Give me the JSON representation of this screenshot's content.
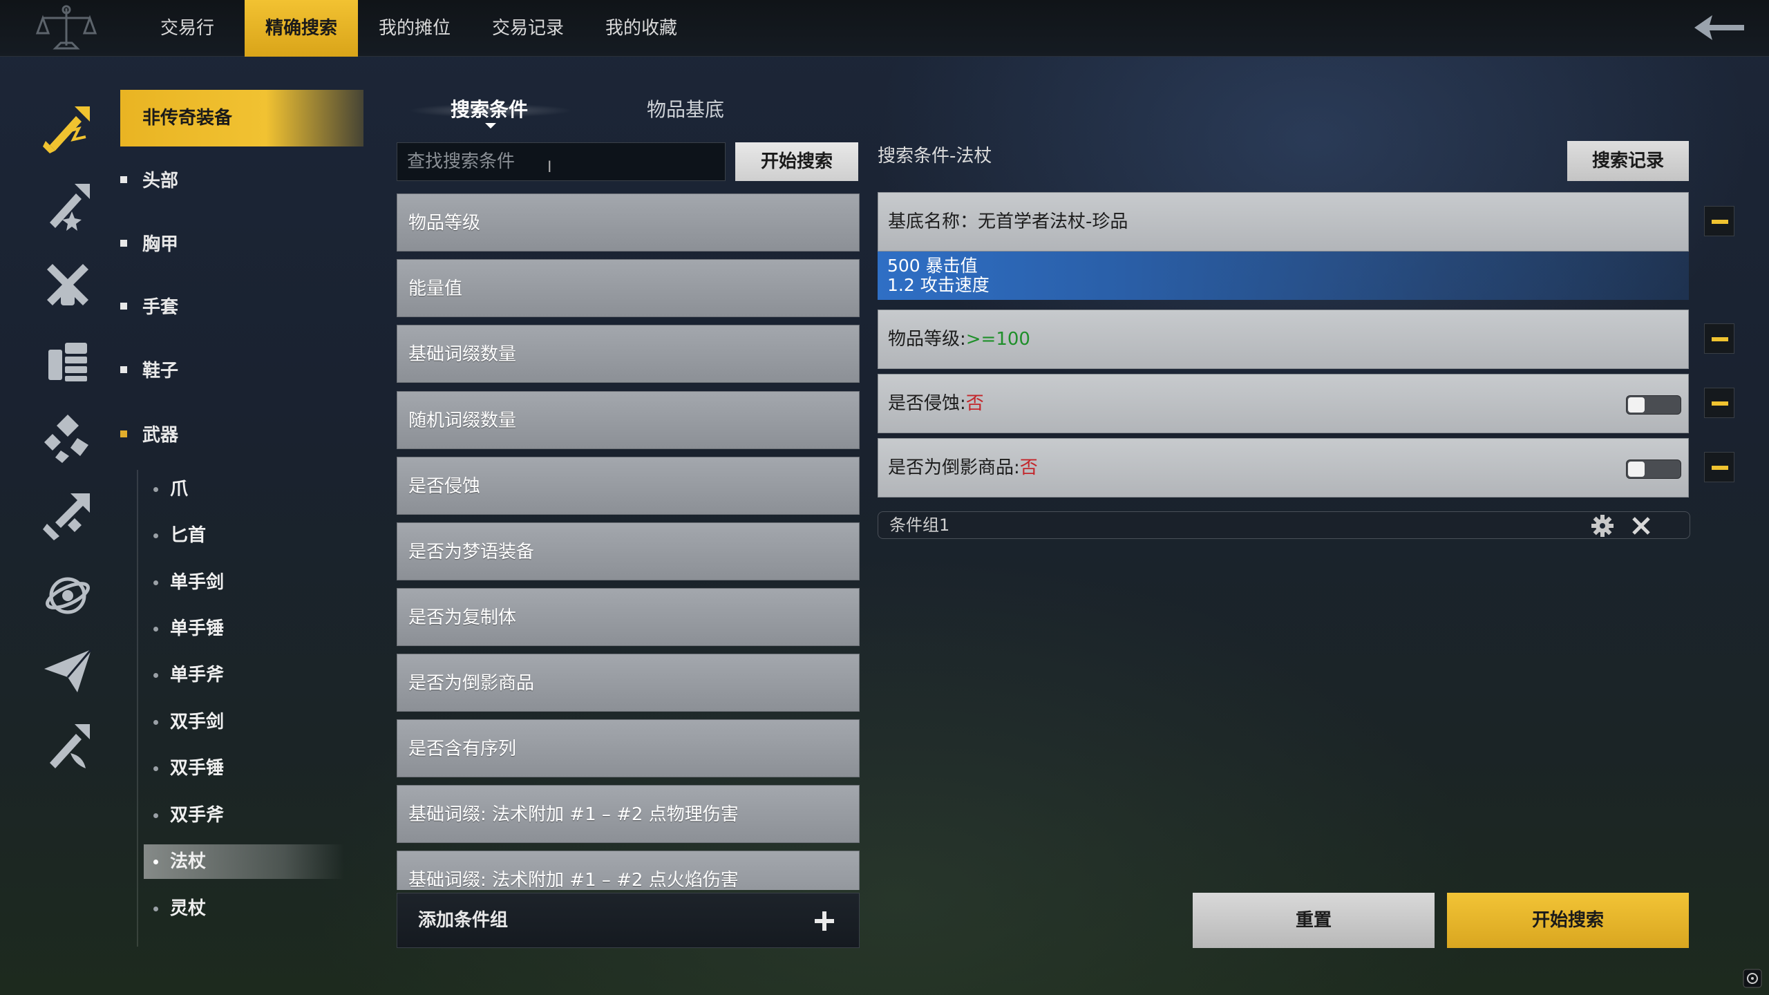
{
  "top_nav": {
    "tabs": [
      {
        "label": "交易行"
      },
      {
        "label": "精确搜索"
      },
      {
        "label": "我的摊位"
      },
      {
        "label": "交易记录"
      },
      {
        "label": "我的收藏"
      }
    ],
    "active_index": 1
  },
  "left_rail": {
    "icons": [
      "sword-lightning-icon",
      "sword-star-icon",
      "armor-icon",
      "inventory-icon",
      "shards-icon",
      "gear-parts-icon",
      "orbit-icon",
      "paper-plane-icon",
      "sword-feather-icon"
    ]
  },
  "category": {
    "active_label": "非传奇装备",
    "items": [
      {
        "label": "头部"
      },
      {
        "label": "胸甲"
      },
      {
        "label": "手套"
      },
      {
        "label": "鞋子"
      },
      {
        "label": "武器"
      }
    ],
    "sub_items": [
      {
        "label": "爪"
      },
      {
        "label": "匕首"
      },
      {
        "label": "单手剑"
      },
      {
        "label": "单手锤"
      },
      {
        "label": "单手斧"
      },
      {
        "label": "双手剑"
      },
      {
        "label": "双手锤"
      },
      {
        "label": "双手斧"
      },
      {
        "label": "法杖"
      },
      {
        "label": "灵杖"
      }
    ],
    "active_sub": "法杖"
  },
  "middle": {
    "tab_conditions": "搜索条件",
    "tab_base": "物品基底",
    "search_placeholder": "查找搜索条件",
    "search_button": "开始搜索",
    "conditions": [
      {
        "label": "物品等级"
      },
      {
        "label": "能量值"
      },
      {
        "label": "基础词缀数量"
      },
      {
        "label": "随机词缀数量"
      },
      {
        "label": "是否侵蚀"
      },
      {
        "label": "是否为梦语装备"
      },
      {
        "label": "是否为复制体"
      },
      {
        "label": "是否为倒影商品"
      },
      {
        "label": "是否含有序列"
      },
      {
        "label": "基础词缀: 法术附加 #1 – #2 点物理伤害"
      },
      {
        "label": "基础词缀: 法术附加 #1 – #2 点火焰伤害"
      }
    ],
    "add_group": "添加条件组"
  },
  "right": {
    "title": "搜索条件-法杖",
    "history_button": "搜索记录",
    "base_name_label": "基底名称：",
    "base_name_value": "无首学者法杖-珍品",
    "base_detail_line1": "500 暴击值",
    "base_detail_line2": "1.2 攻击速度",
    "rule_level_label": "物品等级:",
    "rule_level_value": ">=100",
    "rule_corrupt_label": "是否侵蚀:",
    "rule_corrupt_value": "否",
    "rule_reflect_label": "是否为倒影商品:",
    "rule_reflect_value": "否",
    "group_label": "条件组1",
    "reset_button": "重置",
    "start_button": "开始搜索"
  },
  "colors": {
    "accent_gold": "#f0c330",
    "highlight_blue": "#2f6fc5",
    "value_green": "#1f8f2a",
    "value_red": "#c3262b"
  }
}
